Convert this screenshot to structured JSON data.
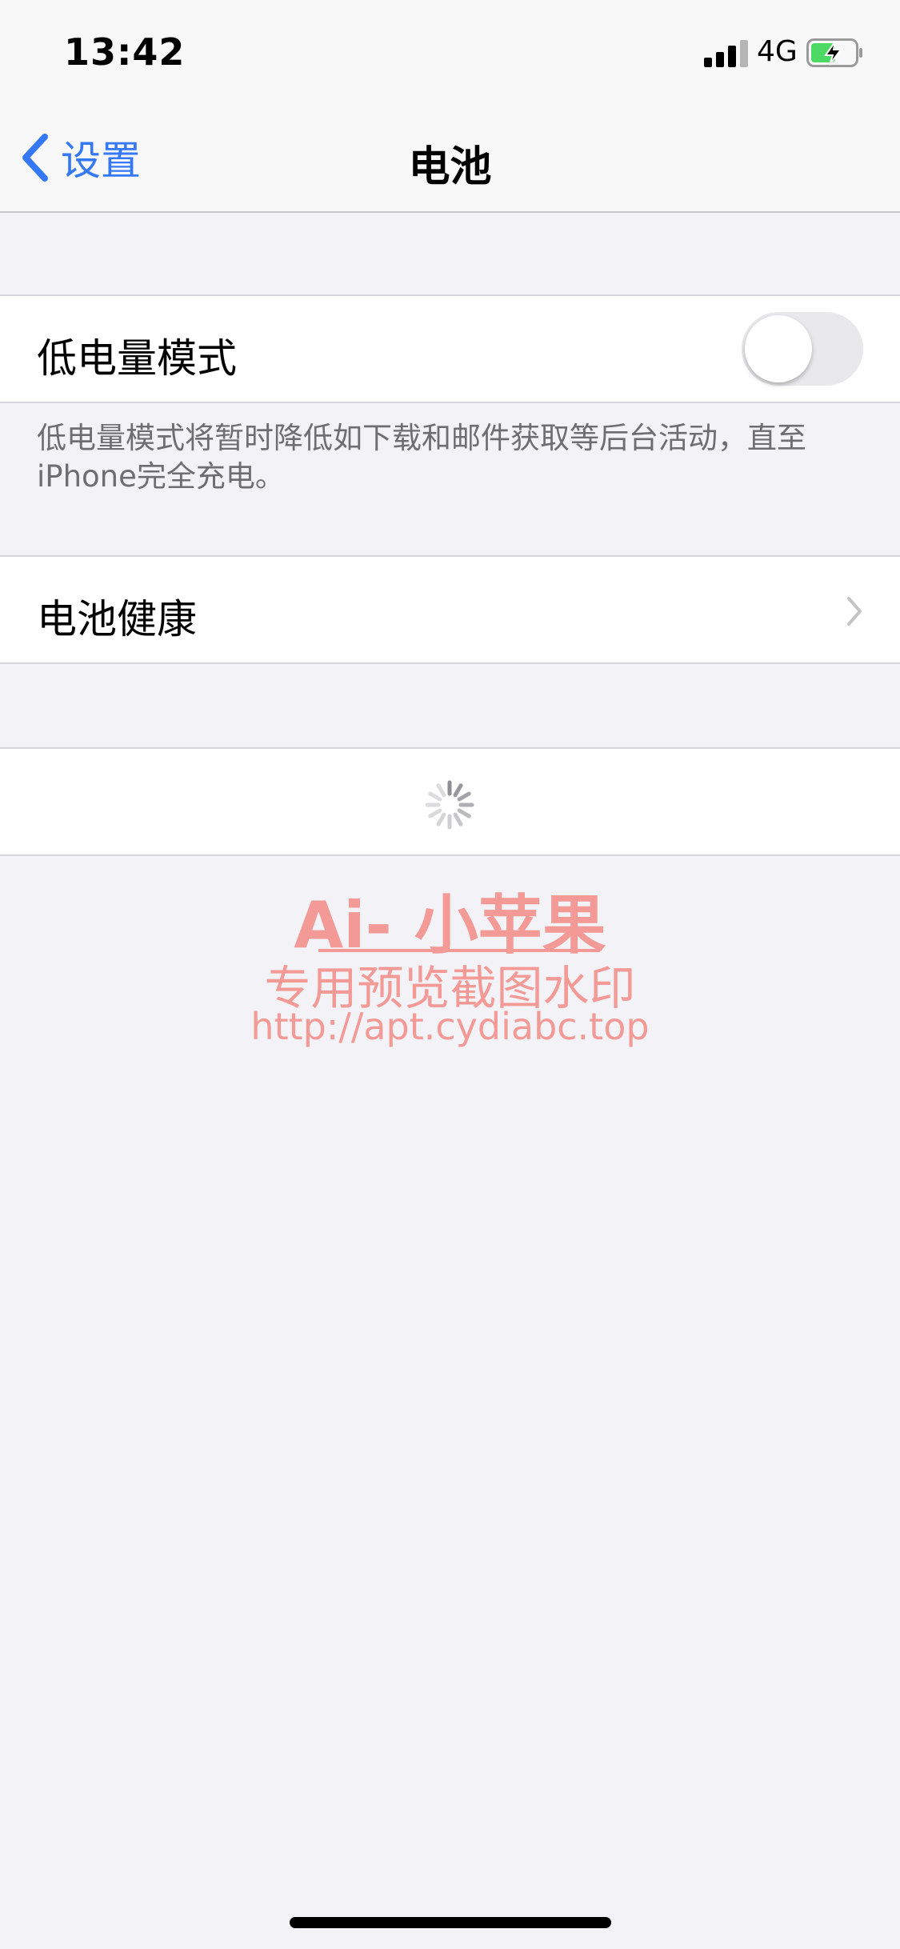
{
  "status_bar": {
    "time": "13:42",
    "network": "4G"
  },
  "nav": {
    "back_label": "设置",
    "title": "电池"
  },
  "low_power": {
    "label": "低电量模式",
    "enabled": false,
    "footer": "低电量模式将暂时降低如下载和邮件获取等后台活动，直至iPhone完全充电。"
  },
  "battery_health": {
    "label": "电池健康"
  },
  "watermark": {
    "title": "Ai- 小苹果",
    "subtitle": "专用预览截图水印",
    "url": "http://apt.cydiabc.top"
  },
  "colors": {
    "accent": "#3478f6",
    "battery_charge": "#4cd964",
    "watermark": "#f39a96"
  }
}
